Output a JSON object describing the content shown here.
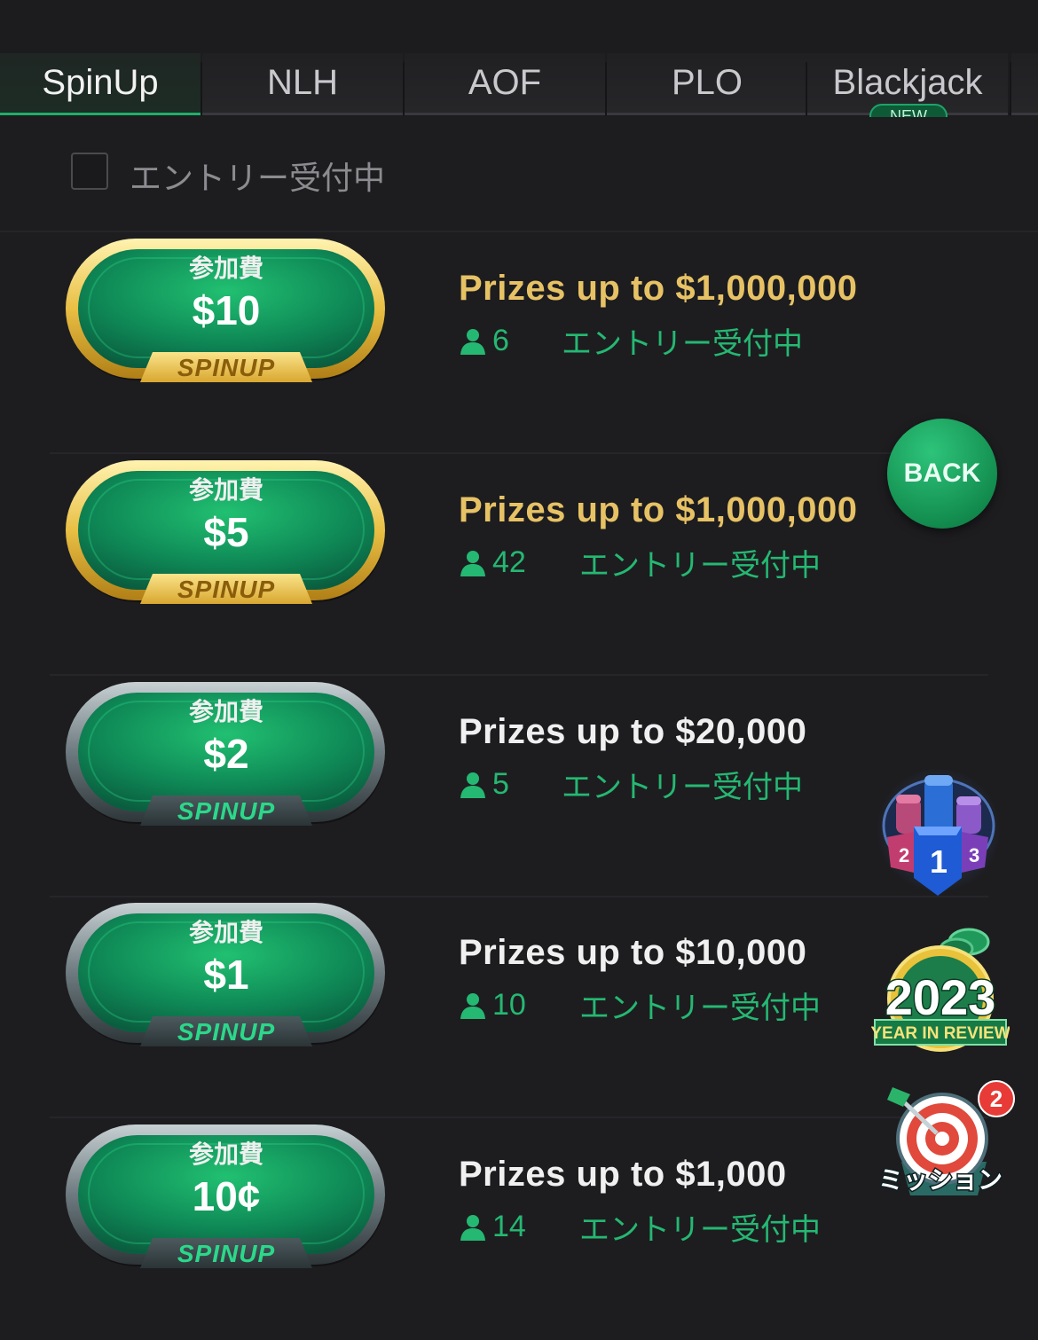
{
  "tabs": [
    {
      "label": "SpinUp"
    },
    {
      "label": "NLH"
    },
    {
      "label": "AOF"
    },
    {
      "label": "PLO"
    },
    {
      "label": "Blackjack"
    }
  ],
  "new_badge": "NEW",
  "filter": {
    "label": "エントリー受付中",
    "checked": false
  },
  "fee_label": "参加費",
  "spinup_label": "SPINUP",
  "rows": [
    {
      "fee": "$10",
      "prize": "Prizes up to $1,000,000",
      "players": "6",
      "status": "エントリー受付中",
      "tier": "gold"
    },
    {
      "fee": "$5",
      "prize": "Prizes up to $1,000,000",
      "players": "42",
      "status": "エントリー受付中",
      "tier": "gold"
    },
    {
      "fee": "$2",
      "prize": "Prizes up to $20,000",
      "players": "5",
      "status": "エントリー受付中",
      "tier": "silver"
    },
    {
      "fee": "$1",
      "prize": "Prizes up to $10,000",
      "players": "10",
      "status": "エントリー受付中",
      "tier": "silver"
    },
    {
      "fee": "10¢",
      "prize": "Prizes up to $1,000",
      "players": "14",
      "status": "エントリー受付中",
      "tier": "silver"
    }
  ],
  "back_button": "BACK",
  "leaderboard_icon": {
    "icon": "podium-chips-icon",
    "ranks": [
      "2",
      "1",
      "3"
    ]
  },
  "year_review_icon": {
    "icon": "year-in-review-icon",
    "year": "2023",
    "caption": "YEAR IN REVIEW"
  },
  "mission_icon": {
    "icon": "target-dart-icon",
    "label": "ミッション",
    "badge": "2"
  },
  "colors": {
    "accent_green": "#25b872",
    "gold_prize": "#e7c265",
    "white_prize": "#f0f0f0"
  }
}
